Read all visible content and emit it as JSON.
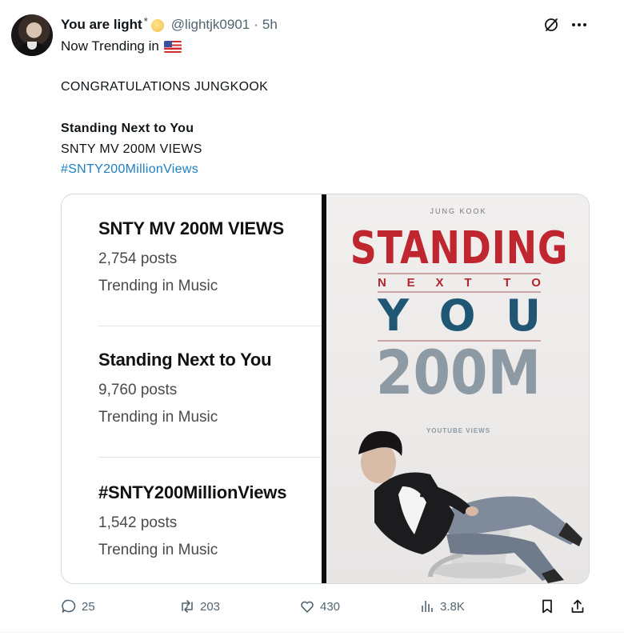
{
  "post": {
    "display_name": "You are light",
    "handle": "@lightjk0901",
    "separator": "·",
    "time": "5h",
    "context_label": "Now Trending in",
    "body_line1": "CONGRATULATIONS JUNGKOOK",
    "body_title": "Standing Next to You",
    "body_line3": "SNTY MV 200M VIEWS",
    "hashtag": "#SNTY200MillionViews"
  },
  "trends": [
    {
      "title": "SNTY MV 200M VIEWS",
      "count": "2,754 posts",
      "category": "Trending in Music"
    },
    {
      "title": "Standing Next to You",
      "count": "9,760 posts",
      "category": "Trending in Music"
    },
    {
      "title": "#SNTY200MillionViews",
      "count": "1,542 posts",
      "category": "Trending in Music"
    }
  ],
  "poster": {
    "top_text": "JUNG KOOK",
    "word1": "STANDING",
    "word2_letters": [
      "N",
      "E",
      "X",
      "T",
      "T",
      "O"
    ],
    "word3_letters": [
      "Y",
      "O",
      "U"
    ],
    "milestone": "200M",
    "subtitle": "YOUTUBE VIEWS"
  },
  "actions": {
    "replies": "25",
    "reposts": "203",
    "likes": "430",
    "views": "3.8K"
  },
  "icons": [
    "grok-icon",
    "more-icon",
    "flag-us-icon",
    "reply-icon",
    "repost-icon",
    "like-icon",
    "views-icon",
    "bookmark-icon",
    "share-icon"
  ],
  "colors": {
    "hashtag": "#1d7fc4",
    "secondary_text": "#536471",
    "poster_red": "#c0262f",
    "poster_blue": "#1e5674"
  }
}
